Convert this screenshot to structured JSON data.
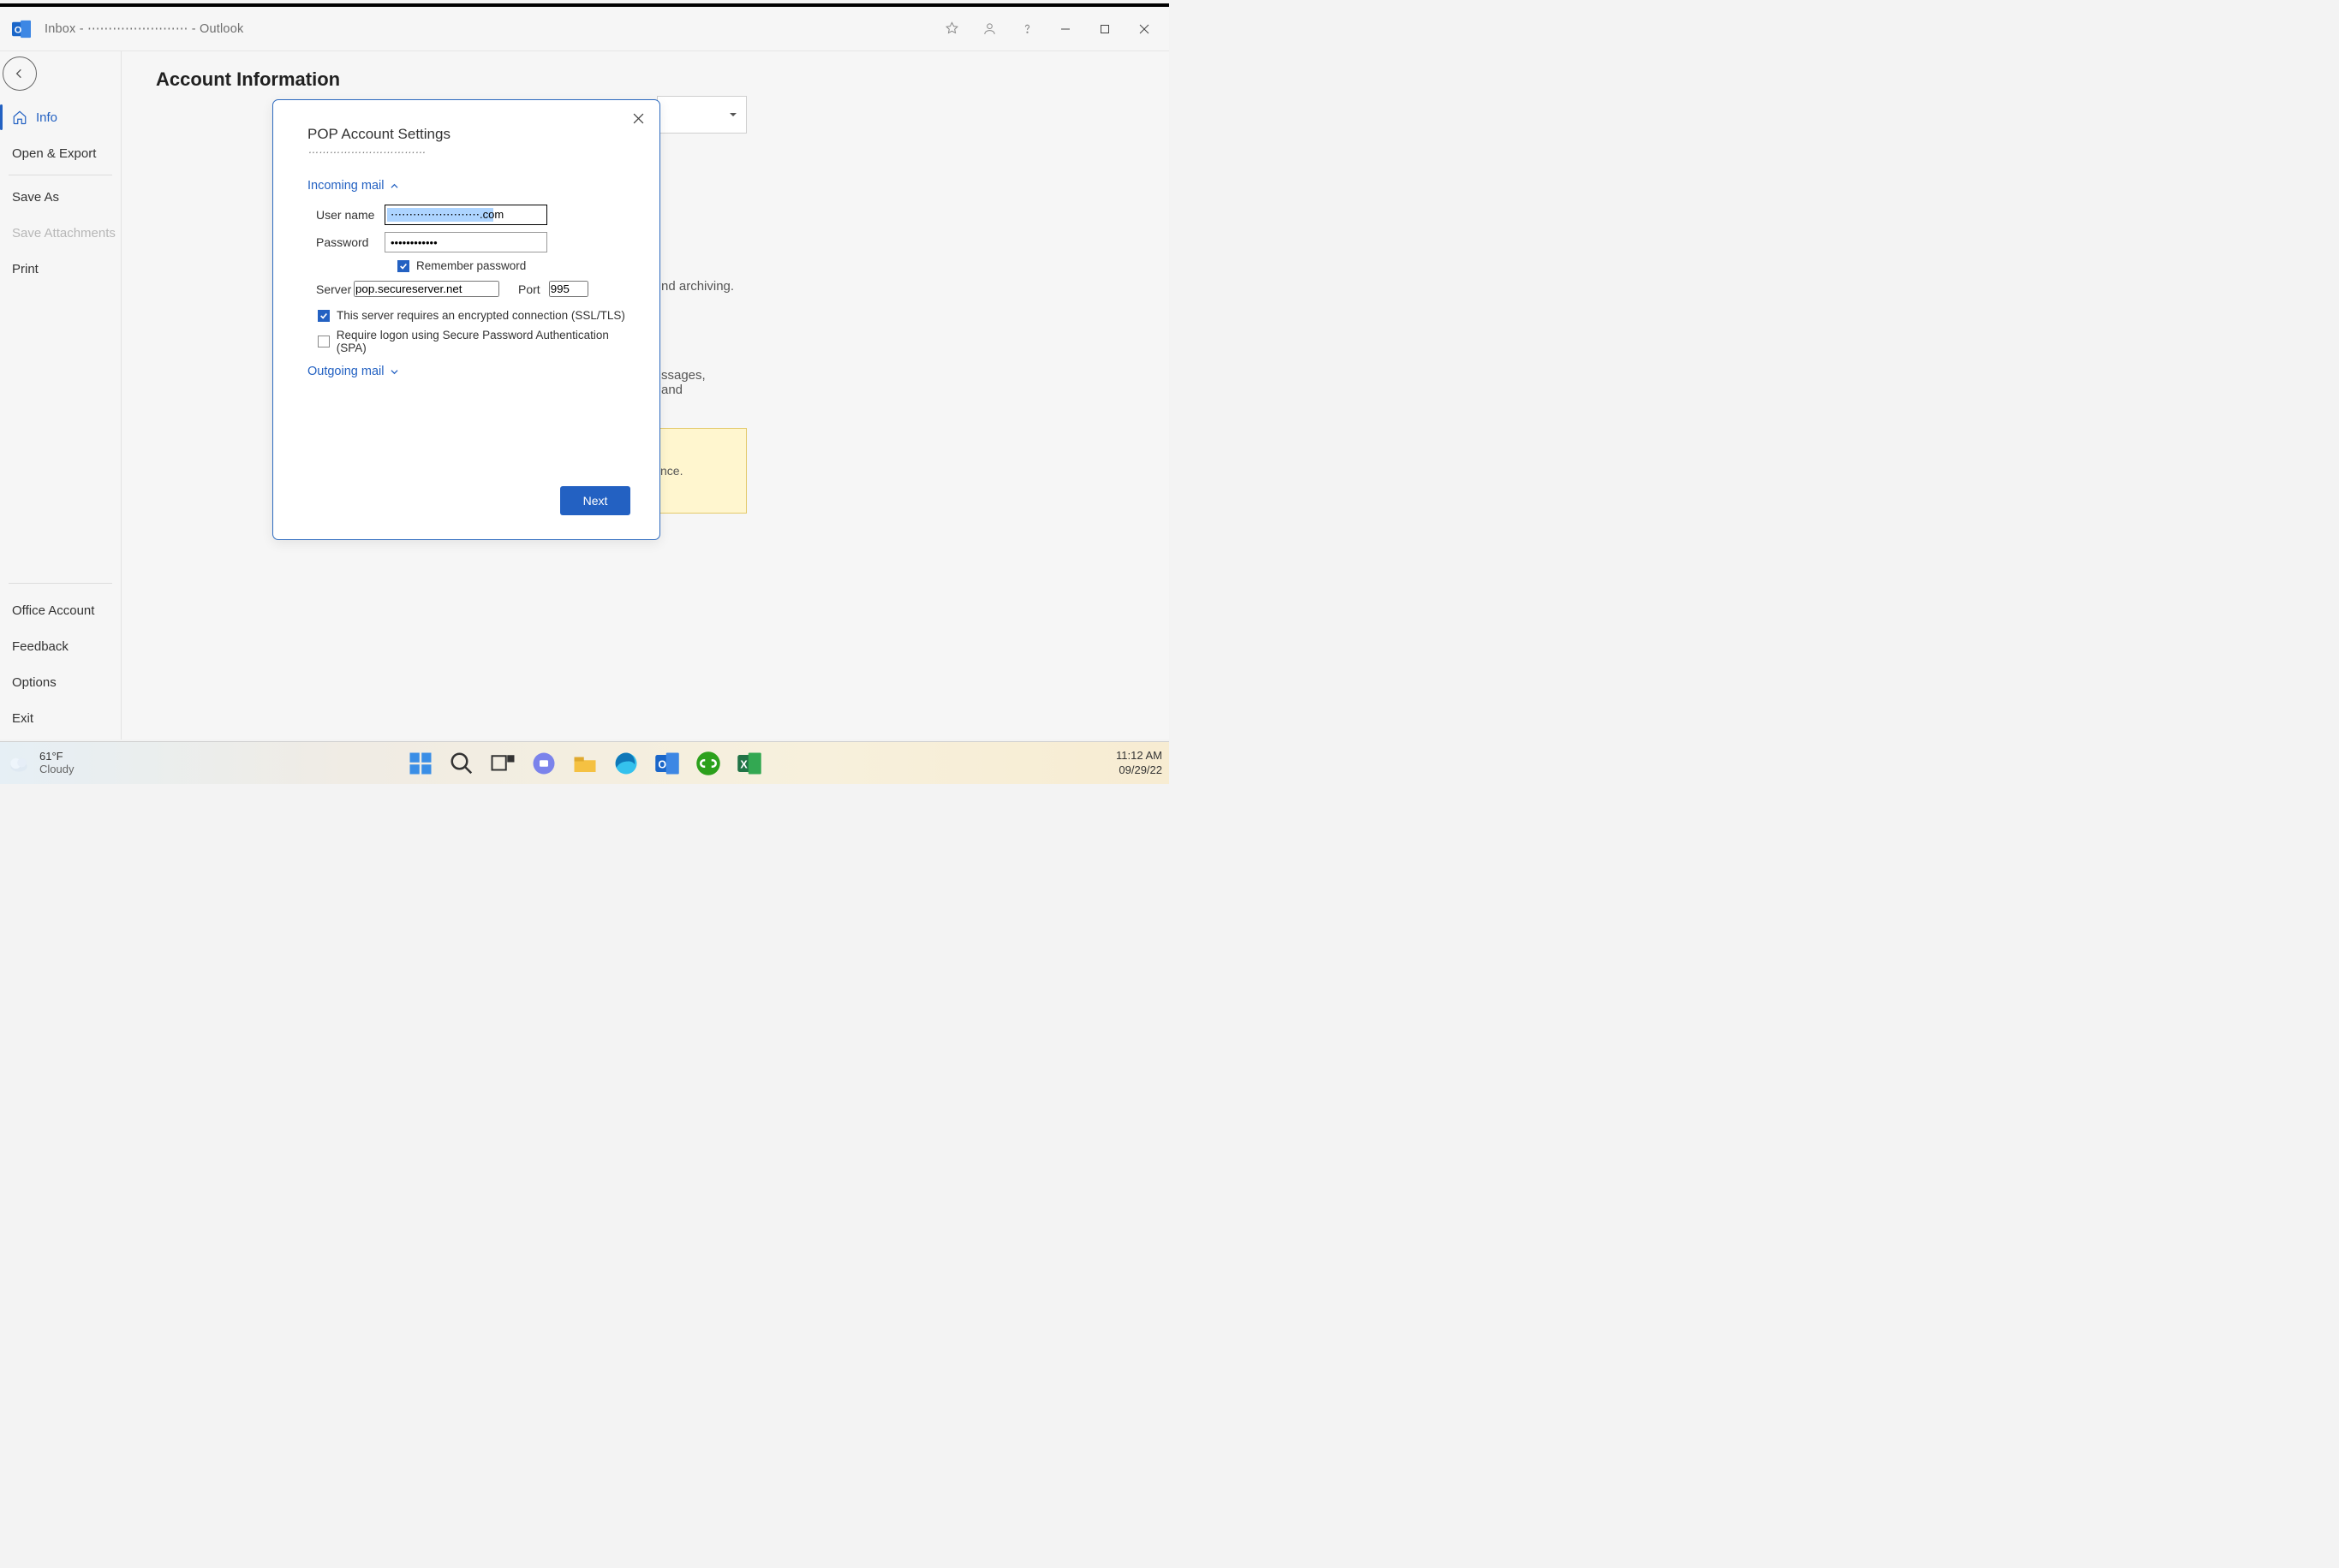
{
  "titlebar": {
    "text": "Inbox - ⋯⋯⋯⋯⋯⋯⋯⋯  -  Outlook"
  },
  "sidebar": {
    "info": "Info",
    "open_export": "Open & Export",
    "save_as": "Save As",
    "save_attachments": "Save Attachments",
    "print": "Print",
    "office_account": "Office Account",
    "feedback": "Feedback",
    "options": "Options",
    "exit": "Exit"
  },
  "main": {
    "page_title": "Account Information",
    "fragment1": "nd archiving.",
    "fragment2": "ssages, and",
    "yellow_text": "nce."
  },
  "dialog": {
    "title": "POP Account Settings",
    "subtitle": "⋯⋯⋯⋯⋯⋯⋯⋯⋯⋯⋯",
    "incoming_label": "Incoming mail",
    "outgoing_label": "Outgoing mail",
    "username_label": "User name",
    "username_value": "⋯⋯⋯⋯⋯⋯⋯⋯.com",
    "password_label": "Password",
    "password_value": "••••••••••••",
    "remember_label": "Remember password",
    "server_label": "Server",
    "server_value": "pop.secureserver.net",
    "port_label": "Port",
    "port_value": "995",
    "ssl_label": "This server requires an encrypted connection (SSL/TLS)",
    "spa_label": "Require logon using Secure Password Authentication (SPA)",
    "next_label": "Next"
  },
  "taskbar": {
    "weather_temp": "61°F",
    "weather_desc": "Cloudy",
    "time": "11:12 AM",
    "date": "09/29/22"
  }
}
